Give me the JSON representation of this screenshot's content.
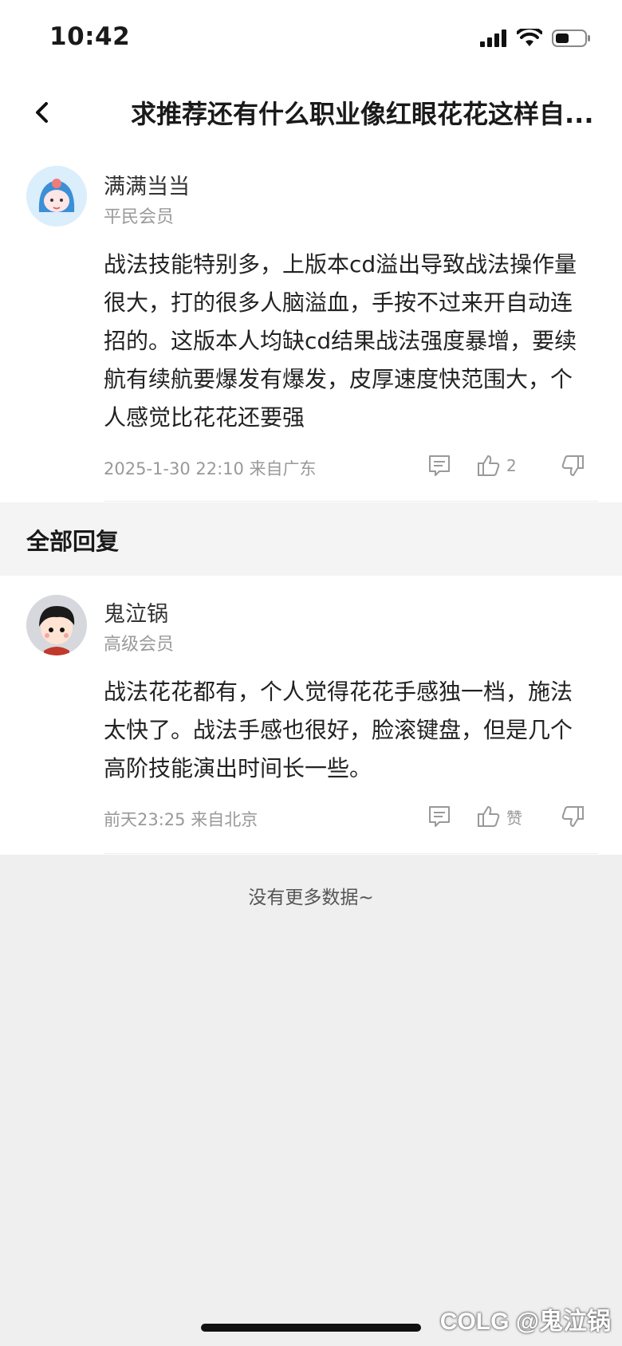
{
  "status_bar": {
    "time": "10:42"
  },
  "nav": {
    "title": "求推荐还有什么职业像红眼花花这样自..."
  },
  "post": {
    "username": "满满当当",
    "level": "平民会员",
    "content": "战法技能特别多，上版本cd溢出导致战法操作量很大，打的很多人脑溢血，手按不过来开自动连招的。这版本人均缺cd结果战法强度暴增，要续航有续航要爆发有爆发，皮厚速度快范围大，个人感觉比花花还要强",
    "meta": "2025-1-30 22:10  来自广东",
    "like_count": "2"
  },
  "section": {
    "title": "全部回复"
  },
  "reply": {
    "username": "鬼泣锅",
    "level": "高级会员",
    "content": "战法花花都有，个人觉得花花手感独一档，施法太快了。战法手感也很好，脸滚键盘，但是几个高阶技能演出时间长一些。",
    "meta": "前天23:25 来自北京",
    "like_label": "赞"
  },
  "footer": {
    "no_more": "没有更多数据~"
  },
  "watermark": "COLG @鬼泣锅",
  "icons": {
    "back": "chevron-left-icon",
    "comment": "comment-icon",
    "like": "thumbs-up-icon",
    "dislike": "thumbs-down-icon",
    "signal": "signal-icon",
    "wifi": "wifi-icon",
    "battery": "battery-icon"
  },
  "colors": {
    "page_bg": "#efefef",
    "card_bg": "#ffffff",
    "muted_text": "#999999",
    "post_avatar_bg": "#cfe6f7",
    "reply_avatar_bg": "#d9dbe0"
  }
}
